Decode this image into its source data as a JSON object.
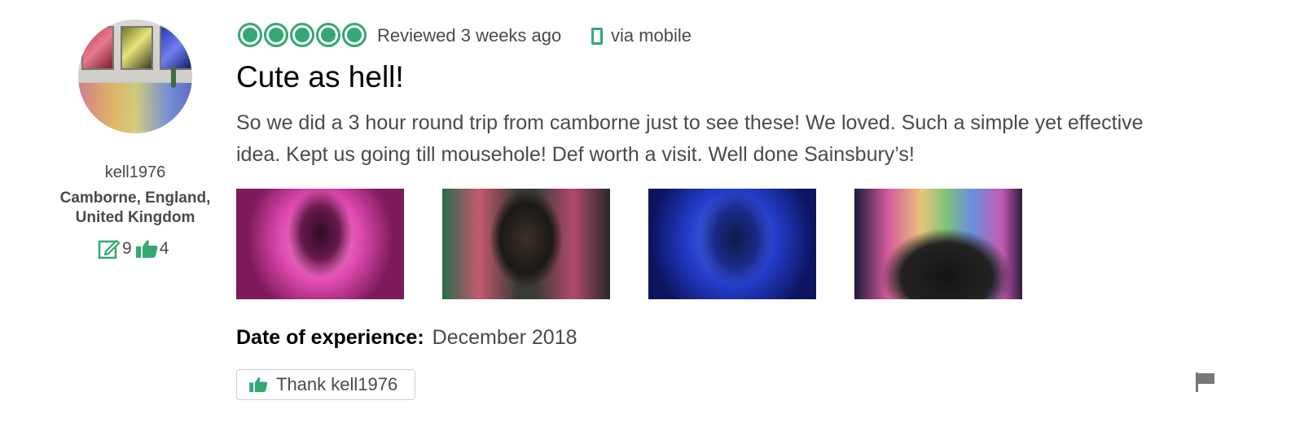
{
  "user": {
    "username": "kell1976",
    "location": "Camborne, England, United Kingdom",
    "review_count": "9",
    "helpful_votes": "4"
  },
  "review": {
    "rating": 5,
    "reviewed_text": "Reviewed 3 weeks ago",
    "device_text": "via mobile",
    "title": "Cute as hell!",
    "body": "So we did a 3 hour round trip from camborne just to see these! We loved. Such a simple yet effective idea. Kept us going till mousehole! Def worth a visit. Well done Sainsbury’s!",
    "date_label": "Date of experience:",
    "date_value": "December 2018",
    "photos_count": 4
  },
  "actions": {
    "thank_label": "Thank kell1976"
  },
  "colors": {
    "accent": "#34a774",
    "text": "#4a4a4a",
    "heading": "#000000"
  },
  "icons": {
    "rating": "bubble-rating-icon",
    "device": "mobile-phone-icon",
    "reviews": "review-pencil-icon",
    "votes": "thumbs-up-icon",
    "report": "flag-icon"
  }
}
